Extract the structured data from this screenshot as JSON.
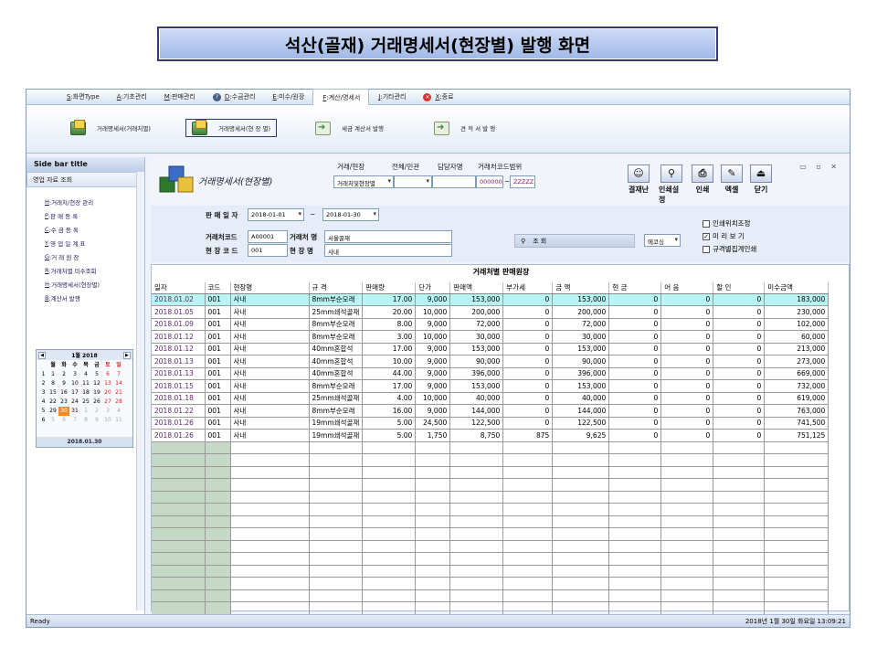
{
  "slide_title": "석산(골재) 거래명세서(현장별) 발행 화면",
  "menu": [
    {
      "key": "S",
      "label": ":화면Type"
    },
    {
      "key": "A",
      "label": ":기초관리"
    },
    {
      "key": "M",
      "label": ":판매관리"
    },
    {
      "key": "D",
      "label": ":수금관리"
    },
    {
      "key": "E",
      "label": ":미수/원장"
    },
    {
      "key": "F",
      "label": ":계산/명세서"
    },
    {
      "key": "J",
      "label": ":기타관리"
    },
    {
      "key": "X",
      "label": ":종료"
    }
  ],
  "ribbon": [
    "거래명세서(거래처별)",
    "거래명세서(현 장 별)",
    "세금 계산서 발행",
    "견 적 서 발 행"
  ],
  "sidebar": {
    "title": "Side bar title",
    "group": "영업 자료 조회",
    "items": [
      {
        "key": "H",
        "label": ":거래처/현장 관리"
      },
      {
        "key": "P",
        "label": ":판 매 등 록"
      },
      {
        "key": "C",
        "label": ":수 금 등 록"
      },
      {
        "key": "Y",
        "label": ":영 업 일 계 표"
      },
      {
        "key": "G",
        "label": ":거 래 원 장"
      },
      {
        "key": "R",
        "label": ":거래처별 미수조회"
      },
      {
        "key": "H",
        "label": ":거래명세서(현장별)"
      },
      {
        "key": "B",
        "label": ":계산서 발행"
      }
    ]
  },
  "calendar": {
    "month": "1월 2018",
    "weekdays": [
      "월",
      "화",
      "수",
      "목",
      "금",
      "토",
      "일"
    ],
    "weeks": [
      {
        "wk": "1",
        "days": [
          "1",
          "2",
          "3",
          "4",
          "5",
          "6",
          "7"
        ]
      },
      {
        "wk": "2",
        "days": [
          "8",
          "9",
          "10",
          "11",
          "12",
          "13",
          "14"
        ]
      },
      {
        "wk": "3",
        "days": [
          "15",
          "16",
          "17",
          "18",
          "19",
          "20",
          "21"
        ]
      },
      {
        "wk": "4",
        "days": [
          "22",
          "23",
          "24",
          "25",
          "26",
          "27",
          "28"
        ]
      },
      {
        "wk": "5",
        "days": [
          "29",
          "30",
          "31",
          "1",
          "2",
          "3",
          "4"
        ]
      },
      {
        "wk": "6",
        "days": [
          "5",
          "6",
          "7",
          "8",
          "9",
          "10",
          "11"
        ]
      }
    ],
    "today_label": "2018.01.30"
  },
  "form": {
    "title": "거래명세서(현장별)",
    "top_labels": {
      "type": "거래/현장",
      "all": "전체/민관",
      "manager": "담당자명",
      "code_range": "거래처코드범위"
    },
    "type_value": "거래처및현장별",
    "code_from": "000000",
    "code_sep": "~",
    "code_to": "ZZZZZ",
    "buttons": [
      "결재난",
      "인쇄설정",
      "인쇄",
      "엑셀",
      "닫기"
    ],
    "window_controls": "▭ ▫ ✕",
    "sale_date_label": "판 매 일 자",
    "date_from": "2018-01-01",
    "date_sep": "~",
    "date_to": "2018-01-30",
    "client_code_label": "거래처코드",
    "client_code": "A00001",
    "client_name_label": "거래처 명",
    "client_name": "서울골재",
    "site_code_label": "현 장 코 드",
    "site_code": "001",
    "site_name_label": "현 장 명",
    "site_name": "사내",
    "search_label": "조 회",
    "select_value": "에코싱",
    "checks": [
      {
        "label": "인쇄위치조정",
        "checked": false
      },
      {
        "label": "미 리 보 기",
        "checked": true
      },
      {
        "label": "규격별집계인쇄",
        "checked": false
      }
    ]
  },
  "grid": {
    "title": "거래처별 판매원장",
    "columns": [
      "일자",
      "코드",
      "현장명",
      "규 격",
      "판매량",
      "단가",
      "판매액",
      "부가세",
      "금 액",
      "현 금",
      "어 음",
      "할 인",
      "미수금액"
    ],
    "rows": [
      [
        "2018.01.02",
        "001",
        "사내",
        "8mm부순모래",
        "17.00",
        "9,000",
        "153,000",
        "0",
        "153,000",
        "0",
        "0",
        "0",
        "183,000"
      ],
      [
        "2018.01.05",
        "001",
        "사내",
        "25mm쇄석골재",
        "20.00",
        "10,000",
        "200,000",
        "0",
        "200,000",
        "0",
        "0",
        "0",
        "230,000"
      ],
      [
        "2018.01.09",
        "001",
        "사내",
        "8mm부순모래",
        "8.00",
        "9,000",
        "72,000",
        "0",
        "72,000",
        "0",
        "0",
        "0",
        "102,000"
      ],
      [
        "2018.01.12",
        "001",
        "사내",
        "8mm부순모래",
        "3.00",
        "10,000",
        "30,000",
        "0",
        "30,000",
        "0",
        "0",
        "0",
        "60,000"
      ],
      [
        "2018.01.12",
        "001",
        "사내",
        "40mm혼합석",
        "17.00",
        "9,000",
        "153,000",
        "0",
        "153,000",
        "0",
        "0",
        "0",
        "213,000"
      ],
      [
        "2018.01.13",
        "001",
        "사내",
        "40mm혼합석",
        "10.00",
        "9,000",
        "90,000",
        "0",
        "90,000",
        "0",
        "0",
        "0",
        "273,000"
      ],
      [
        "2018.01.13",
        "001",
        "사내",
        "40mm혼합석",
        "44.00",
        "9,000",
        "396,000",
        "0",
        "396,000",
        "0",
        "0",
        "0",
        "669,000"
      ],
      [
        "2018.01.15",
        "001",
        "사내",
        "8mm부순모래",
        "17.00",
        "9,000",
        "153,000",
        "0",
        "153,000",
        "0",
        "0",
        "0",
        "732,000"
      ],
      [
        "2018.01.18",
        "001",
        "사내",
        "25mm쇄석골재",
        "4.00",
        "10,000",
        "40,000",
        "0",
        "40,000",
        "0",
        "0",
        "0",
        "619,000"
      ],
      [
        "2018.01.22",
        "001",
        "사내",
        "8mm부순모래",
        "16.00",
        "9,000",
        "144,000",
        "0",
        "144,000",
        "0",
        "0",
        "0",
        "763,000"
      ],
      [
        "2018.01.26",
        "001",
        "사내",
        "19mm쇄석골재",
        "5.00",
        "24,500",
        "122,500",
        "0",
        "122,500",
        "0",
        "0",
        "0",
        "741,500"
      ],
      [
        "2018.01.26",
        "001",
        "사내",
        "19mm쇄석골재",
        "5.00",
        "1,750",
        "8,750",
        "875",
        "9,625",
        "0",
        "0",
        "0",
        "751,125"
      ]
    ],
    "empty_rows": 14
  },
  "status": {
    "left": "Ready",
    "right": "2018년 1월 30일 화요일 13:09:21"
  }
}
